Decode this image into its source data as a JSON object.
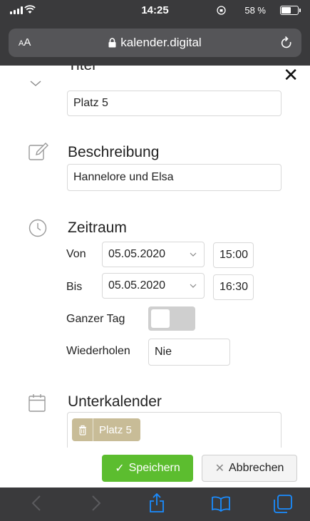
{
  "status_bar": {
    "time": "14:25",
    "battery_percent": "58 %",
    "battery_level": 0.58
  },
  "browser": {
    "text_size_label": "AA",
    "url": "kalender.digital"
  },
  "form": {
    "title_section": {
      "label": "Titel",
      "value": "Platz 5"
    },
    "description_section": {
      "label": "Beschreibung",
      "value": "Hannelore und Elsa"
    },
    "timerange_section": {
      "label": "Zeitraum",
      "from_label": "Von",
      "from_date": "05.05.2020",
      "from_time": "15:00",
      "to_label": "Bis",
      "to_date": "05.05.2020",
      "to_time": "16:30",
      "all_day_label": "Ganzer Tag",
      "all_day": false,
      "repeat_label": "Wiederholen",
      "repeat_value": "Nie"
    },
    "subcalendar_section": {
      "label": "Unterkalender",
      "tag": "Platz 5",
      "tag_color": "#c8bc97"
    }
  },
  "actions": {
    "save_label": "Speichern",
    "cancel_label": "Abbrechen",
    "save_color": "#5cbd2f"
  }
}
